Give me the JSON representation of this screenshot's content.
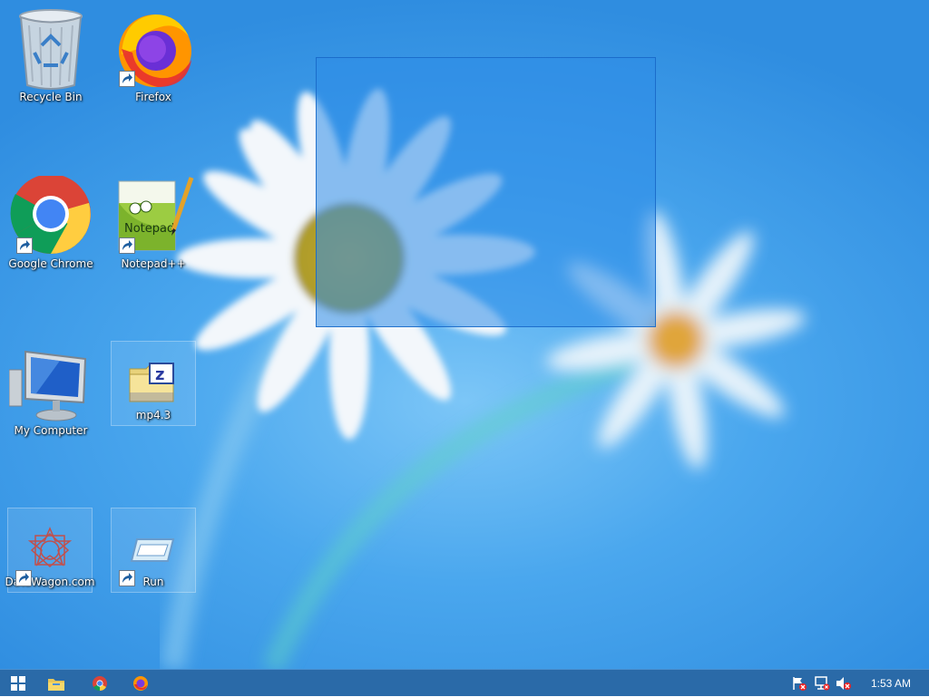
{
  "desktop": {
    "icons": [
      {
        "label": "Recycle Bin",
        "icon": "recycle-bin-icon"
      },
      {
        "label": "Firefox",
        "icon": "firefox-icon"
      },
      {
        "label": "Google Chrome",
        "icon": "chrome-icon"
      },
      {
        "label": "Notepad++",
        "icon": "notepad-plus-plus-icon"
      },
      {
        "label": "My Computer",
        "icon": "computer-icon"
      },
      {
        "label": "mp4.3",
        "icon": "zip-folder-icon"
      },
      {
        "label": "DataWagon.com",
        "icon": "datawagon-icon"
      },
      {
        "label": "Run",
        "icon": "run-icon"
      }
    ]
  },
  "taskbar": {
    "pinned": [
      "start-icon",
      "file-explorer-icon",
      "chrome-icon",
      "firefox-icon"
    ],
    "tray": [
      "action-center-flag-icon",
      "network-icon",
      "volume-muted-icon"
    ],
    "clock": "1:53 AM"
  },
  "colors": {
    "taskbar": "#2a6aa8",
    "selection": "#2e8ce8"
  }
}
